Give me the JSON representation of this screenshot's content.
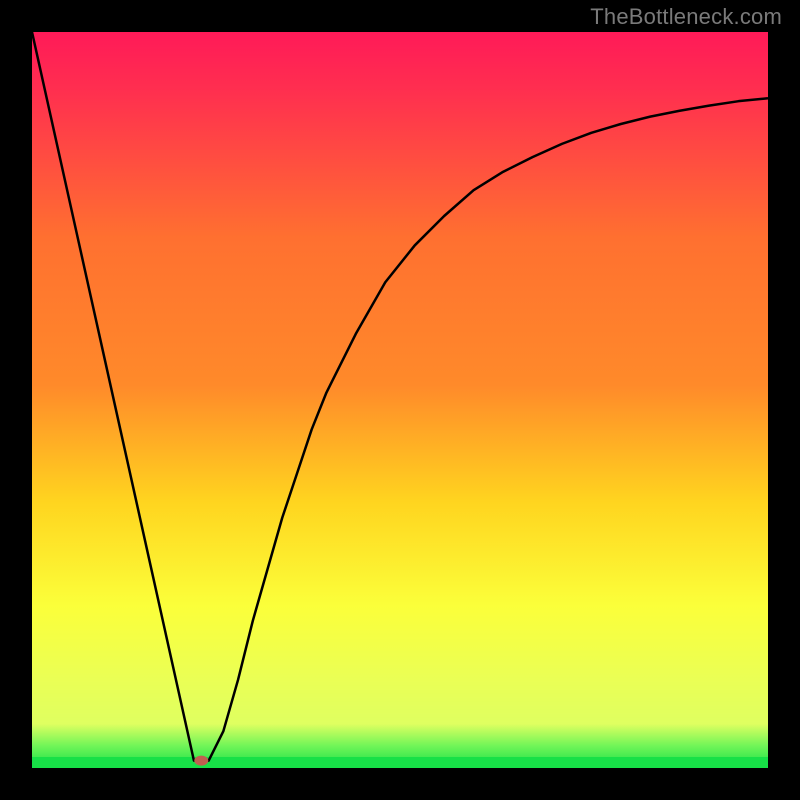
{
  "watermark": "TheBottleneck.com",
  "chart_data": {
    "type": "line",
    "title": "",
    "xlabel": "",
    "ylabel": "",
    "xlim": [
      0,
      100
    ],
    "ylim": [
      0,
      100
    ],
    "grid": false,
    "x": [
      0,
      2,
      4,
      6,
      8,
      10,
      12,
      14,
      16,
      18,
      20,
      21,
      22,
      23,
      24,
      26,
      28,
      30,
      32,
      34,
      36,
      38,
      40,
      44,
      48,
      52,
      56,
      60,
      64,
      68,
      72,
      76,
      80,
      84,
      88,
      92,
      96,
      100
    ],
    "values": [
      100,
      91,
      82,
      73,
      64,
      55,
      46,
      37,
      28,
      19,
      10,
      5.5,
      1,
      1,
      1,
      5,
      12,
      20,
      27,
      34,
      40,
      46,
      51,
      59,
      66,
      71,
      75,
      78.5,
      81,
      83,
      84.8,
      86.3,
      87.5,
      88.5,
      89.3,
      90,
      90.6,
      91
    ],
    "marker_point": {
      "x": 23,
      "y": 1
    },
    "gradient_colors": {
      "top": "#ff1a58",
      "mid_upper": "#ff8a2a",
      "mid": "#ffd51f",
      "mid_lower": "#fbff3a",
      "bottom_band": "#dfff60",
      "green": "#17e047"
    },
    "frame_thickness_px": 32,
    "legend": false,
    "annotations": []
  }
}
